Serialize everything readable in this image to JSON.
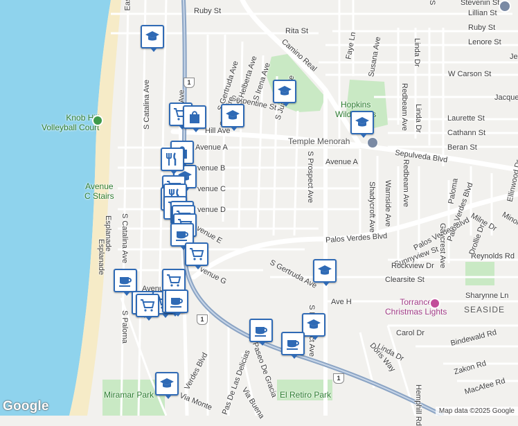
{
  "map": {
    "attribution": "Map data ©2025 Google",
    "logo": "Google",
    "colors": {
      "water": "#8fd3ed",
      "beach": "#f6ebc7",
      "road": "#ffffff",
      "highway": "#8ba4c4",
      "park": "#c9e9c4",
      "land": "#f2f1ee",
      "marker_border": "#2f6ab5"
    },
    "street_labels": [
      {
        "text": "Ruby St",
        "rot": 0
      },
      {
        "text": "Rita St",
        "rot": 0
      },
      {
        "text": "Stevenin St",
        "rot": 0
      },
      {
        "text": "Lillian St",
        "rot": 0
      },
      {
        "text": "Ruby St",
        "rot": 0
      },
      {
        "text": "Lenore St",
        "rot": 0
      },
      {
        "text": "W Carson St",
        "rot": 0
      },
      {
        "text": "Jacque",
        "rot": 0
      },
      {
        "text": "Laurette St",
        "rot": 0
      },
      {
        "text": "Cathann St",
        "rot": 0
      },
      {
        "text": "Beran St",
        "rot": 0
      },
      {
        "text": "Sepulveda Blvd",
        "rot": 0
      },
      {
        "text": "Avenue A",
        "rot": 0
      },
      {
        "text": "Avenue A",
        "rot": 0
      },
      {
        "text": "venue B",
        "rot": 0
      },
      {
        "text": "venue C",
        "rot": 0
      },
      {
        "text": "venue D",
        "rot": 0
      },
      {
        "text": "venue E",
        "rot": 0
      },
      {
        "text": "venue G",
        "rot": 0
      },
      {
        "text": "Avenue",
        "rot": 0
      },
      {
        "text": "Hill Ave",
        "rot": 0
      },
      {
        "text": "Serpentine St",
        "rot": 0
      },
      {
        "text": "Camino Real",
        "rot": 0
      },
      {
        "text": "Palos Verdes Blvd",
        "rot": 0
      },
      {
        "text": "Palos Verdes Blvd",
        "rot": 0
      },
      {
        "text": "Sunnyview St",
        "rot": 0
      },
      {
        "text": "Rockview Dr",
        "rot": 0
      },
      {
        "text": "Clearsite St",
        "rot": 0
      },
      {
        "text": "Reynolds Rd",
        "rot": 0
      },
      {
        "text": "Sharynne Ln",
        "rot": 0
      },
      {
        "text": "Ave H",
        "rot": 0
      },
      {
        "text": "Carol Dr",
        "rot": 0
      },
      {
        "text": "Bindewald Rd",
        "rot": 0
      },
      {
        "text": "Zakon Rd",
        "rot": 0
      },
      {
        "text": "MacAfee Rd",
        "rot": 0
      },
      {
        "text": "Linda Dr",
        "rot": 0
      },
      {
        "text": "Doris Way",
        "rot": 0
      },
      {
        "text": "Verdes Blvd",
        "rot": 0
      },
      {
        "text": "Paseo De Gracia",
        "rot": 0
      },
      {
        "text": "Via Buena",
        "rot": 0
      },
      {
        "text": "Pas De Las Delicias",
        "rot": 0
      },
      {
        "text": "Via Monte",
        "rot": 0
      },
      {
        "text": "S Catalina Ave",
        "rot": 0
      },
      {
        "text": "S Catalina Ave",
        "rot": 0
      },
      {
        "text": "Esplanade",
        "rot": 0
      },
      {
        "text": "Elvira Ave",
        "rot": 0
      },
      {
        "text": "S Gertruda Ave",
        "rot": 0
      },
      {
        "text": "Sapphire",
        "rot": 0
      },
      {
        "text": "S Helberta Ave",
        "rot": 0
      },
      {
        "text": "S Irena Ave",
        "rot": 0
      },
      {
        "text": "S Juanita Ave",
        "rot": 0
      },
      {
        "text": "Faye Ln",
        "rot": 0
      },
      {
        "text": "Susana Ave",
        "rot": 0
      },
      {
        "text": "S Prospect Ave",
        "rot": 0
      },
      {
        "text": "Redbeam Ave",
        "rot": 0
      },
      {
        "text": "Redbeam Ave",
        "rot": 0
      },
      {
        "text": "Linda Dr",
        "rot": 0
      },
      {
        "text": "Linda Dr",
        "rot": 0
      },
      {
        "text": "Shadycroft Ave",
        "rot": 0
      },
      {
        "text": "Warnside Ave",
        "rot": 0
      },
      {
        "text": "Palos Verdes Blvd",
        "rot": 0
      },
      {
        "text": "Gaycrest Ave",
        "rot": 0
      },
      {
        "text": "Ellinwood Dr",
        "rot": 0
      },
      {
        "text": "Milne Dr",
        "rot": 0
      },
      {
        "text": "Drollie Dr",
        "rot": 0
      },
      {
        "text": "Minor",
        "rot": 0
      },
      {
        "text": "Paloma",
        "rot": 0
      },
      {
        "text": "S Gertruda Ave",
        "rot": 0
      },
      {
        "text": "S Prospect Ave",
        "rot": 0
      },
      {
        "text": "Esplanade",
        "rot": 0
      },
      {
        "text": "Hemphill Rd",
        "rot": 0
      },
      {
        "text": "Eas",
        "rot": 0
      },
      {
        "text": "S Paloma",
        "rot": 0
      },
      {
        "text": "Je",
        "rot": 0
      },
      {
        "text": "S",
        "rot": 0
      }
    ],
    "pois": [
      {
        "text": "Knob Hill\nVolleyball Court",
        "style": "green"
      },
      {
        "text": "Avenue\nC Stairs",
        "style": "green"
      },
      {
        "text": "Hopkins\nWilderness",
        "style": "green"
      },
      {
        "text": "Temple Menorah",
        "style": "gray"
      },
      {
        "text": "Torrance\nChristmas Lights",
        "style": "pink"
      },
      {
        "text": "El Retiro Park",
        "style": "green"
      },
      {
        "text": "Miramar Park",
        "style": "green"
      }
    ],
    "area_labels": [
      "SEASIDE"
    ],
    "shields": [
      "1",
      "1",
      "1"
    ],
    "markers": [
      {
        "icon": "school"
      },
      {
        "icon": "school"
      },
      {
        "icon": "school"
      },
      {
        "icon": "school"
      },
      {
        "icon": "school"
      },
      {
        "icon": "school"
      },
      {
        "icon": "school"
      },
      {
        "icon": "school"
      },
      {
        "icon": "cart"
      },
      {
        "icon": "shopping-bag"
      },
      {
        "icon": "shopping-bag"
      },
      {
        "icon": "restaurant"
      },
      {
        "icon": "cart"
      },
      {
        "icon": "cart"
      },
      {
        "icon": "restaurant"
      },
      {
        "icon": "cart"
      },
      {
        "icon": "cart"
      },
      {
        "icon": "cart"
      },
      {
        "icon": "cart"
      },
      {
        "icon": "cafe"
      },
      {
        "icon": "cart"
      },
      {
        "icon": "cafe"
      },
      {
        "icon": "cart"
      },
      {
        "icon": "cart"
      },
      {
        "icon": "cart"
      },
      {
        "icon": "cafe"
      },
      {
        "icon": "cafe"
      },
      {
        "icon": "cafe"
      },
      {
        "icon": "cart"
      },
      {
        "icon": "cafe"
      }
    ]
  }
}
